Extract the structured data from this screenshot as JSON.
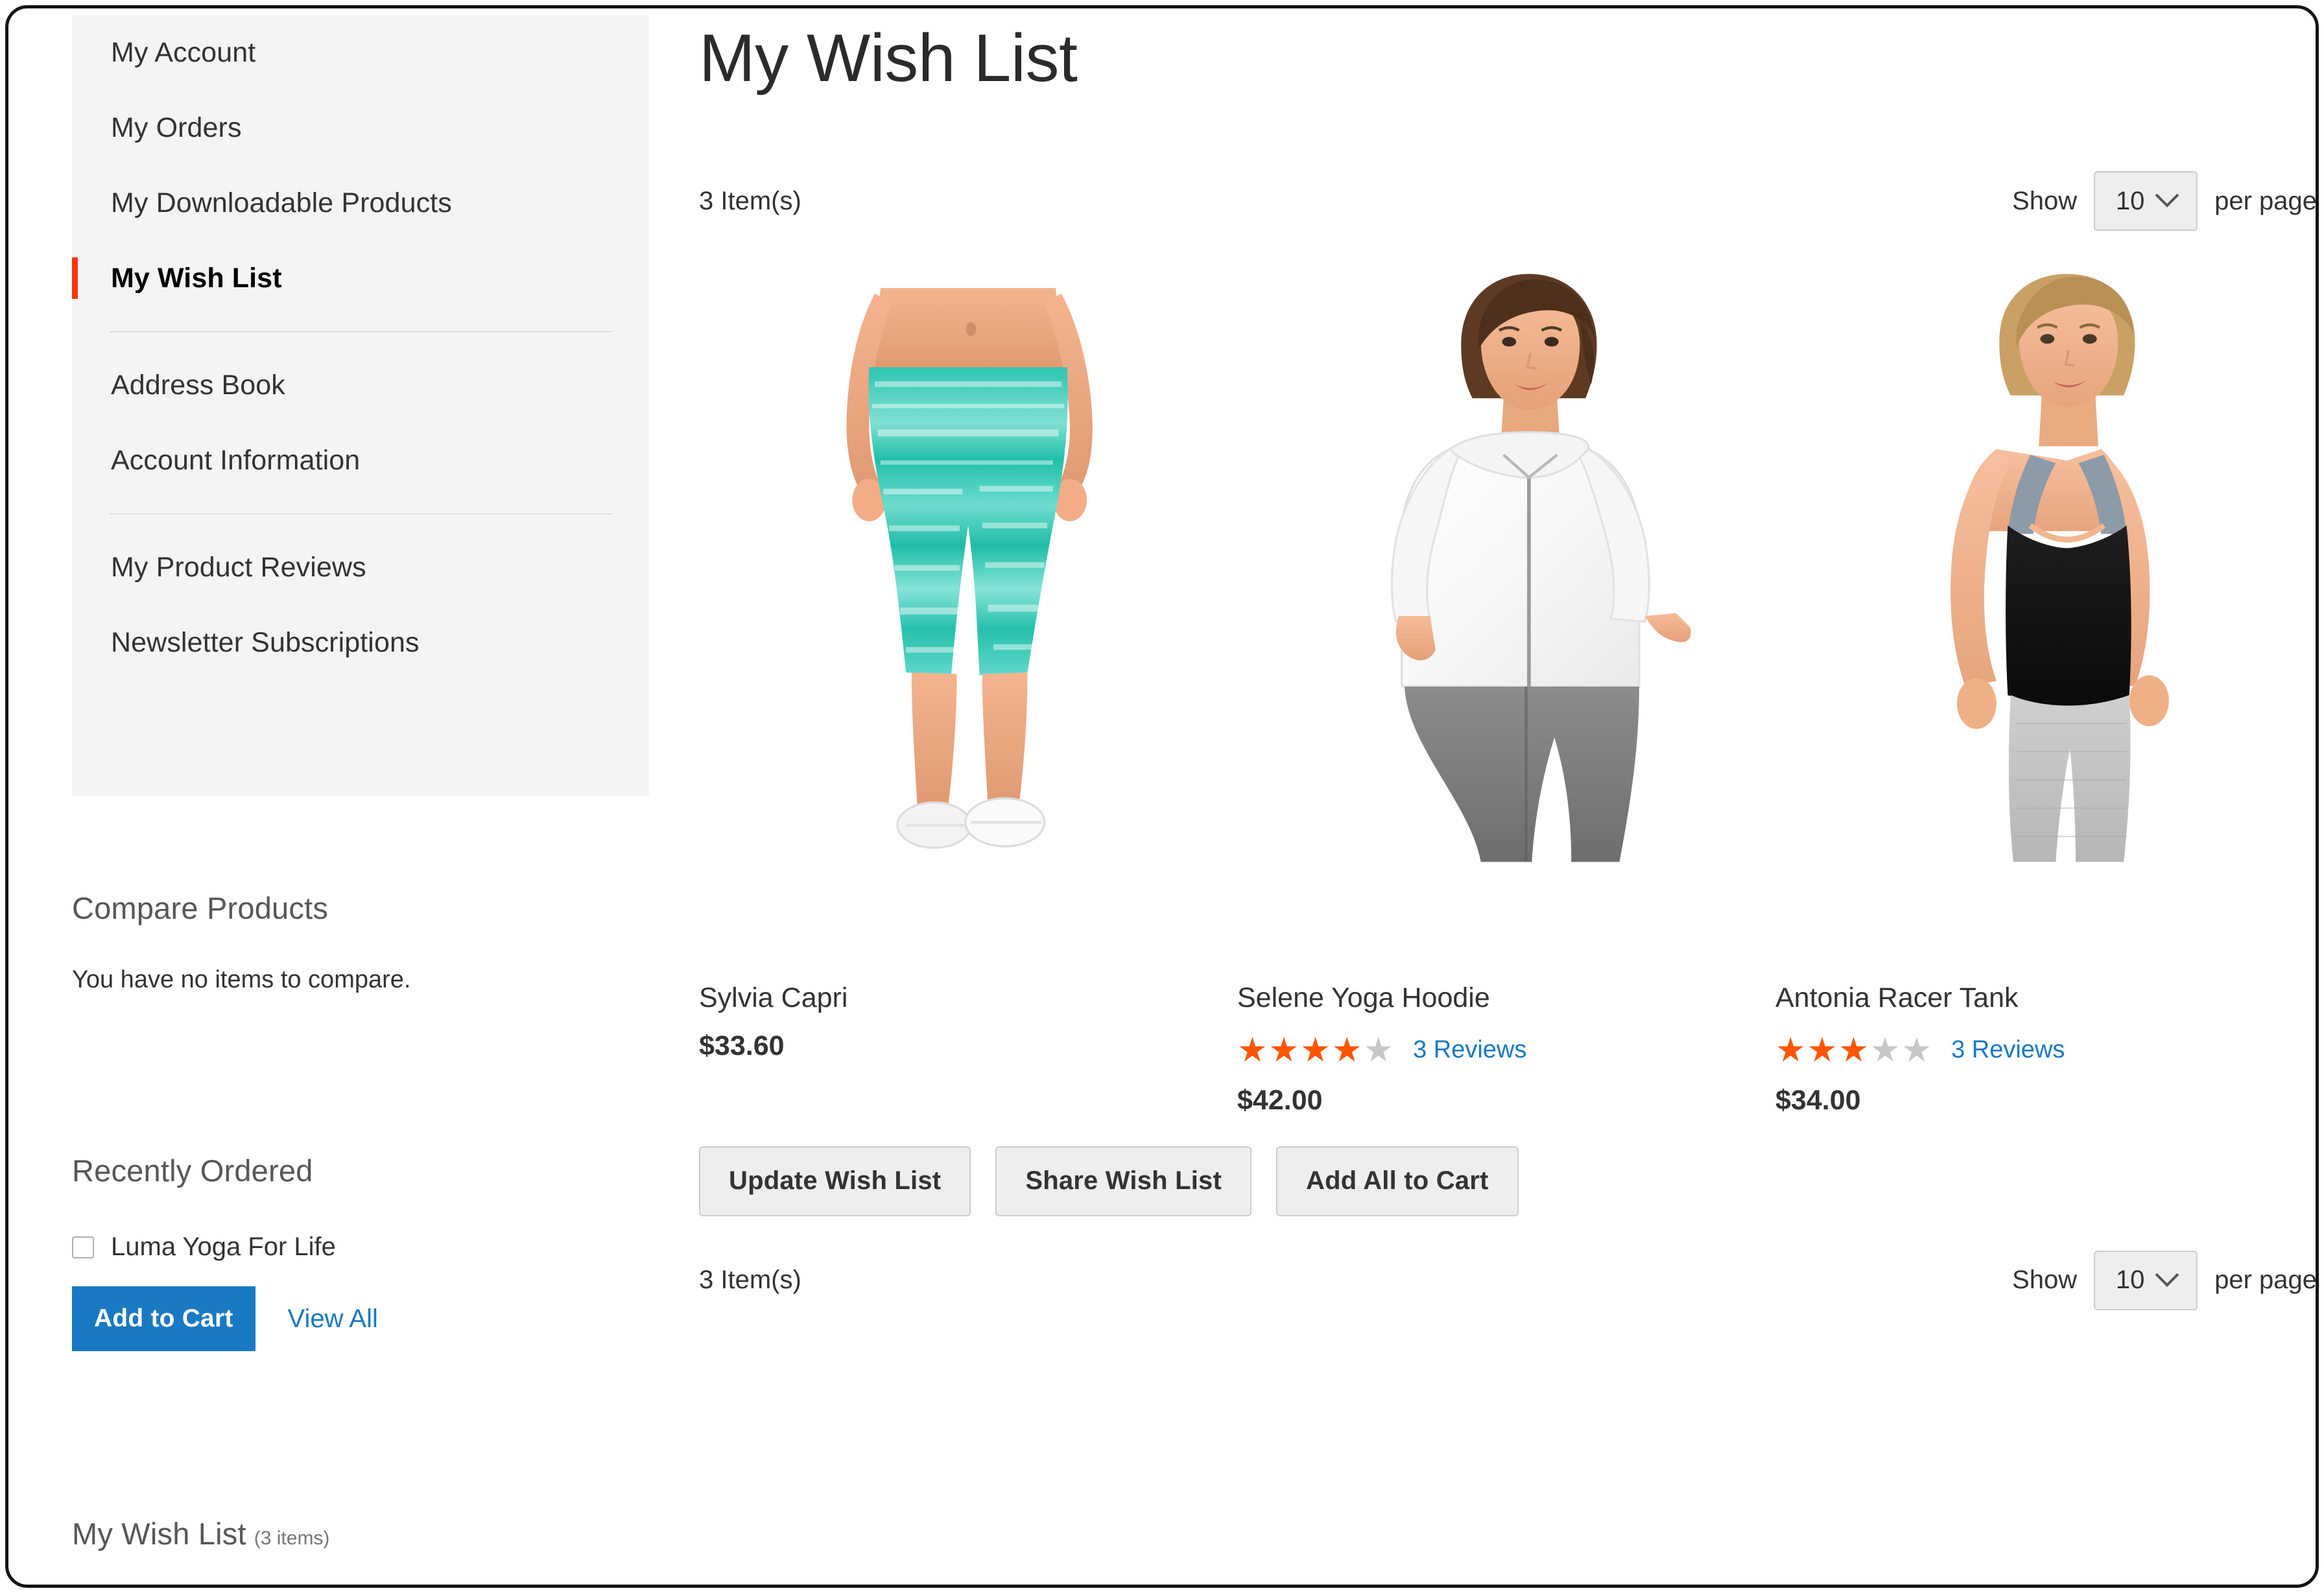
{
  "page": {
    "title": "My Wish List"
  },
  "sidebar": {
    "nav_items": [
      {
        "label": "My Account",
        "current": false
      },
      {
        "label": "My Orders",
        "current": false
      },
      {
        "label": "My Downloadable Products",
        "current": false
      },
      {
        "label": "My Wish List",
        "current": true
      },
      {
        "label": "Address Book",
        "current": false
      },
      {
        "label": "Account Information",
        "current": false
      },
      {
        "label": "My Product Reviews",
        "current": false
      },
      {
        "label": "Newsletter Subscriptions",
        "current": false
      }
    ],
    "compare": {
      "title": "Compare Products",
      "empty_text": "You have no items to compare."
    },
    "recently_ordered": {
      "title": "Recently Ordered",
      "item_label": "Luma Yoga For Life",
      "add_to_cart_label": "Add to Cart",
      "view_all_label": "View All"
    },
    "wishlist_widget": {
      "title": "My Wish List",
      "count_text": "(3 items)"
    }
  },
  "toolbar_top": {
    "amount": "3 Item(s)",
    "show_label": "Show",
    "per_page_value": "10",
    "per_page_label": "per page"
  },
  "toolbar_bottom": {
    "amount": "3 Item(s)",
    "show_label": "Show",
    "per_page_value": "10",
    "per_page_label": "per page"
  },
  "products": [
    {
      "name": "Sylvia Capri",
      "price": "$33.60",
      "has_rating": false,
      "rating_percent": 0,
      "reviews_label": ""
    },
    {
      "name": "Selene Yoga Hoodie",
      "price": "$42.00",
      "has_rating": true,
      "rating_percent": 80,
      "reviews_label": "3 Reviews"
    },
    {
      "name": "Antonia Racer Tank",
      "price": "$34.00",
      "has_rating": true,
      "rating_percent": 60,
      "reviews_label": "3 Reviews"
    }
  ],
  "actions": {
    "update_label": "Update Wish List",
    "share_label": "Share Wish List",
    "add_all_label": "Add All to Cart"
  },
  "colors": {
    "accent_red": "#ff3300",
    "star_orange": "#ff5501",
    "link_blue": "#1979c3",
    "sidebar_bg": "#f4f4f4"
  }
}
